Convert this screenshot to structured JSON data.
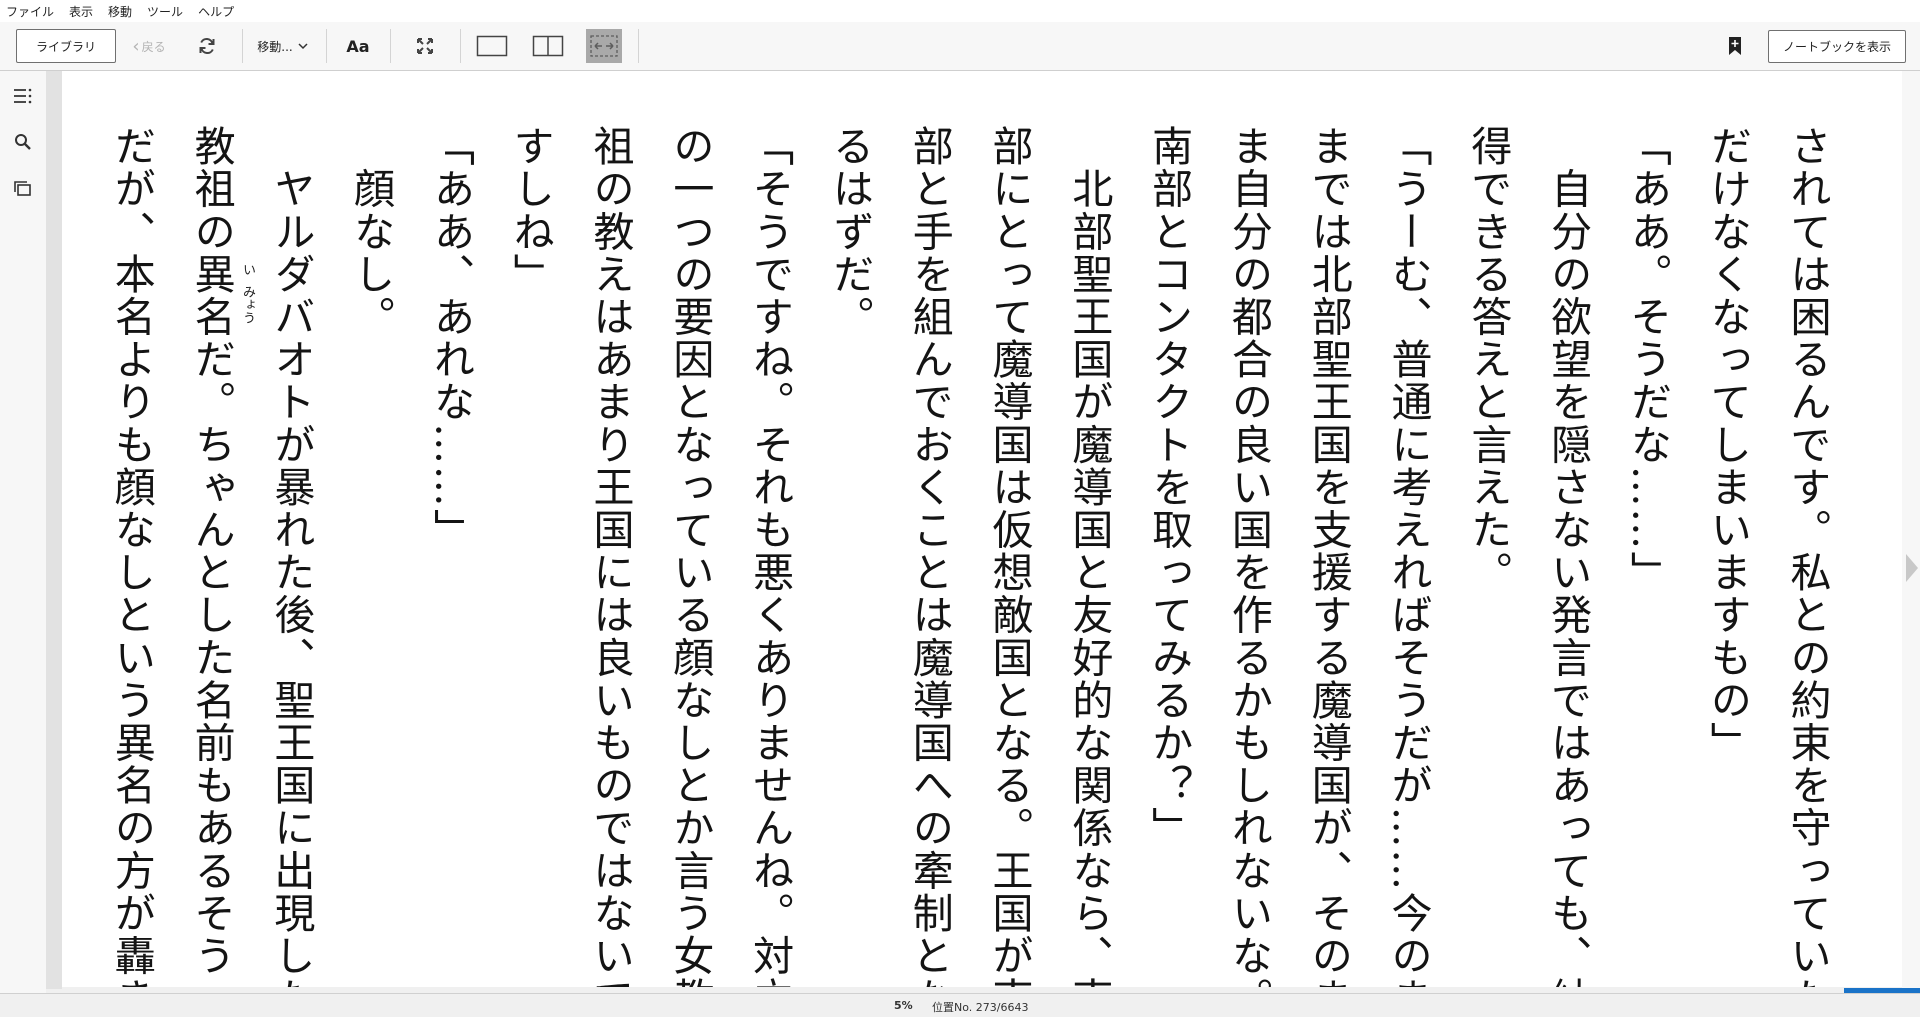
{
  "menu": [
    "ファイル",
    "表示",
    "移動",
    "ツール",
    "ヘルプ"
  ],
  "toolbar": {
    "library_label": "ライブラリ",
    "back_label": "戻る",
    "goto_label": "移動...",
    "font_label": "Aa",
    "notebook_label": "ノートブックを表示"
  },
  "book": {
    "columns": [
      "されては困るんです。私との約束を守っていた",
      "だけなくなってしまいますもの」",
      "「ああ。そうだな……」",
      "　自分の欲望を隠さない発言ではあっても、納",
      "得できる答えと言えた。",
      "「うーむ、普通に考えればそうだが……今のま",
      "までは北部聖王国を支援する魔導国が、そのま",
      "ま自分の都合の良い国を作るかもしれないな。",
      "南部とコンタクトを取ってみるか？」",
      "　北部聖王国が魔導国と友好的な関係なら、南",
      "部にとって魔導国は仮想敵国となる。王国が南",
      "部と手を組んでおくことは魔導国への牽制とな",
      "るはずだ。",
      "「そうですね。それも悪くありませんね。対立",
      "の一つの要因となっている顔なしとか言う女教",
      "祖の教えはあまり王国には良いものではないで",
      "すしね」",
      "「ああ、あれな……」",
      "　顔なし。",
      "　ヤルダバオトが暴れた後、聖王国に出現した",
      "教祖の異名だ。ちゃんとした名前もあるそう",
      "だが、本名よりも顔なしという異名の方が轟き"
    ],
    "ruby": [
      {
        "text": "い",
        "base": "異"
      },
      {
        "text": "みょう",
        "base": "名"
      }
    ]
  },
  "status": {
    "percent": "5%",
    "location": "位置No. 273/6643",
    "progress": 0.05
  }
}
